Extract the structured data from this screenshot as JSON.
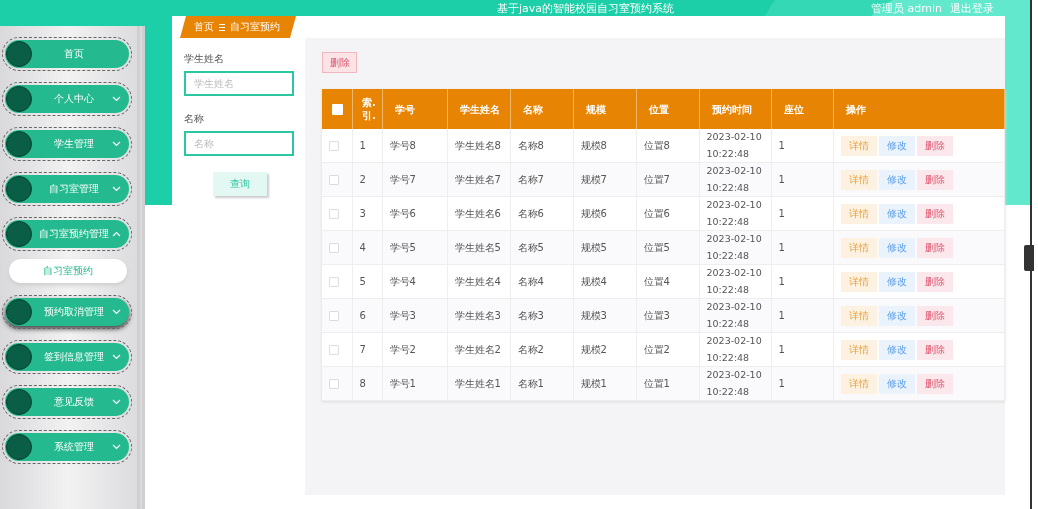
{
  "header": {
    "title": "基于java的智能校园自习室预约系统",
    "user": "管理员 admin",
    "logout": "退出登录"
  },
  "sidebar": {
    "items": [
      {
        "label": "首页",
        "kind": "link",
        "hovered": false
      },
      {
        "label": "个人中心",
        "kind": "menu",
        "expanded": false,
        "hovered": false
      },
      {
        "label": "学生管理",
        "kind": "menu",
        "expanded": false,
        "hovered": false
      },
      {
        "label": "自习室管理",
        "kind": "menu",
        "expanded": false,
        "hovered": false
      },
      {
        "label": "自习室预约管理",
        "kind": "menu",
        "expanded": true,
        "hovered": false,
        "children": [
          {
            "label": "自习室预约"
          }
        ]
      },
      {
        "label": "预约取消管理",
        "kind": "menu",
        "expanded": false,
        "hovered": true
      },
      {
        "label": "签到信息管理",
        "kind": "menu",
        "expanded": false,
        "hovered": false
      },
      {
        "label": "意见反馈",
        "kind": "menu",
        "expanded": false,
        "hovered": false
      },
      {
        "label": "系统管理",
        "kind": "menu",
        "expanded": false,
        "hovered": false
      }
    ]
  },
  "breadcrumb": [
    "首页",
    "自习室预约"
  ],
  "search": {
    "fields": [
      {
        "label": "学生姓名",
        "placeholder": "学生姓名"
      },
      {
        "label": "名称",
        "placeholder": "名称"
      }
    ],
    "button": "查询"
  },
  "toolbar": {
    "delete_button": "删除"
  },
  "table": {
    "select_all_checked": false,
    "columns": [
      "索.引.",
      "学号",
      "学生姓名",
      "名称",
      "规模",
      "位置",
      "预约时间",
      "座位",
      "操作"
    ],
    "rows": [
      {
        "checked": false,
        "cells": [
          "1",
          "学号8",
          "学生姓名8",
          "名称8",
          "规模8",
          "位置8",
          "2023-02-10 10:22:48",
          "1"
        ],
        "actions": [
          {
            "kind": "detail",
            "label": "详情"
          },
          {
            "kind": "edit",
            "label": "修改"
          },
          {
            "kind": "delete",
            "label": "删除"
          }
        ]
      },
      {
        "checked": false,
        "cells": [
          "2",
          "学号7",
          "学生姓名7",
          "名称7",
          "规模7",
          "位置7",
          "2023-02-10 10:22:48",
          "1"
        ],
        "actions": [
          {
            "kind": "detail",
            "label": "详情"
          },
          {
            "kind": "edit",
            "label": "修改"
          },
          {
            "kind": "delete",
            "label": "删除"
          }
        ]
      },
      {
        "checked": false,
        "cells": [
          "3",
          "学号6",
          "学生姓名6",
          "名称6",
          "规模6",
          "位置6",
          "2023-02-10 10:22:48",
          "1"
        ],
        "actions": [
          {
            "kind": "detail",
            "label": "详情"
          },
          {
            "kind": "edit",
            "label": "修改"
          },
          {
            "kind": "delete",
            "label": "删除"
          }
        ]
      },
      {
        "checked": false,
        "cells": [
          "4",
          "学号5",
          "学生姓名5",
          "名称5",
          "规模5",
          "位置5",
          "2023-02-10 10:22:48",
          "1"
        ],
        "actions": [
          {
            "kind": "detail",
            "label": "详情"
          },
          {
            "kind": "edit",
            "label": "修改"
          },
          {
            "kind": "delete",
            "label": "删除"
          }
        ]
      },
      {
        "checked": false,
        "cells": [
          "5",
          "学号4",
          "学生姓名4",
          "名称4",
          "规模4",
          "位置4",
          "2023-02-10 10:22:48",
          "1"
        ],
        "actions": [
          {
            "kind": "detail",
            "label": "详情"
          },
          {
            "kind": "edit",
            "label": "修改"
          },
          {
            "kind": "delete",
            "label": "删除"
          }
        ]
      },
      {
        "checked": false,
        "cells": [
          "6",
          "学号3",
          "学生姓名3",
          "名称3",
          "规模3",
          "位置3",
          "2023-02-10 10:22:48",
          "1"
        ],
        "actions": [
          {
            "kind": "detail",
            "label": "详情"
          },
          {
            "kind": "edit",
            "label": "修改"
          },
          {
            "kind": "delete",
            "label": "删除"
          }
        ]
      },
      {
        "checked": false,
        "cells": [
          "7",
          "学号2",
          "学生姓名2",
          "名称2",
          "规模2",
          "位置2",
          "2023-02-10 10:22:48",
          "1"
        ],
        "actions": [
          {
            "kind": "detail",
            "label": "详情"
          },
          {
            "kind": "edit",
            "label": "修改"
          },
          {
            "kind": "delete",
            "label": "删除"
          }
        ]
      },
      {
        "checked": false,
        "cells": [
          "8",
          "学号1",
          "学生姓名1",
          "名称1",
          "规模1",
          "位置1",
          "2023-02-10 10:22:48",
          "1"
        ],
        "actions": [
          {
            "kind": "detail",
            "label": "详情"
          },
          {
            "kind": "edit",
            "label": "修改"
          },
          {
            "kind": "delete",
            "label": "删除"
          }
        ]
      }
    ]
  }
}
